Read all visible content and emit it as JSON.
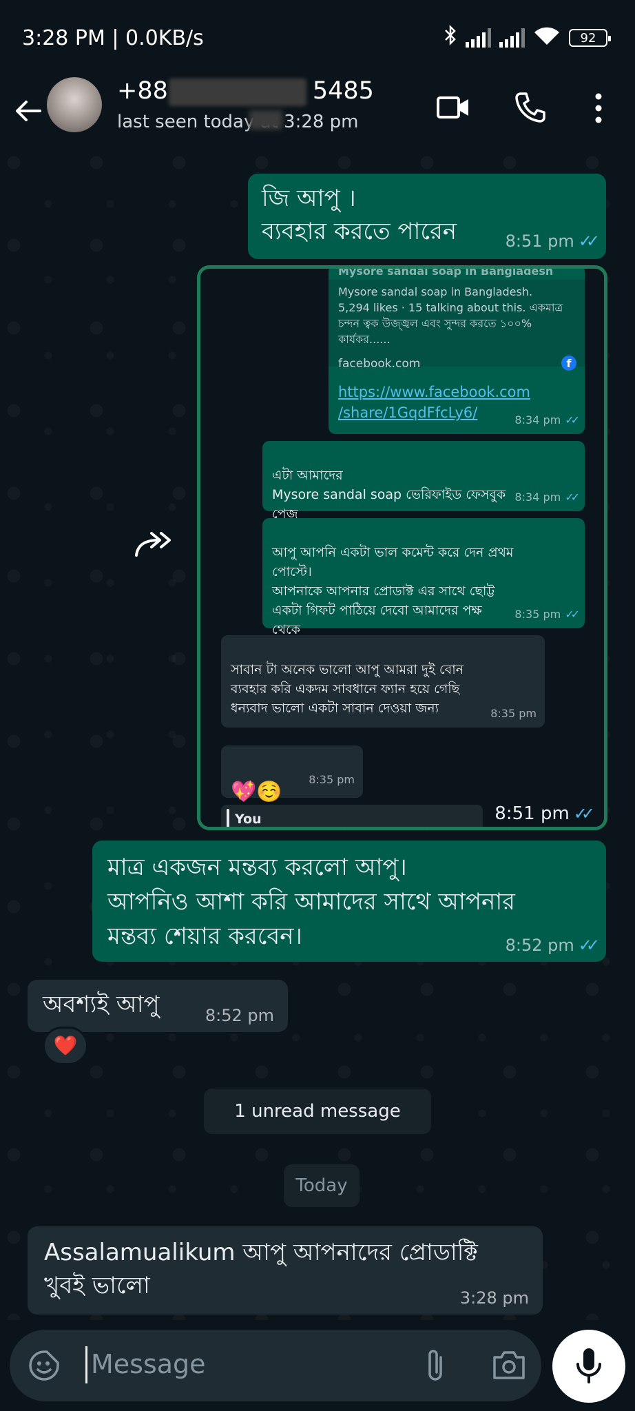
{
  "status_bar": {
    "time": "3:28 PM | 0.0KB/s",
    "battery": "92",
    "icons": [
      "bluetooth-icon",
      "signal-icon",
      "signal-icon",
      "wifi-icon",
      "battery-icon"
    ]
  },
  "header": {
    "contact_name": "+88",
    "contact_suffix": "5485",
    "last_seen": "last seen today at 3:28 pm",
    "icons": [
      "back-arrow-icon",
      "video-call-icon",
      "voice-call-icon",
      "more-options-icon"
    ]
  },
  "messages": {
    "m1": {
      "text": "জি আপু ।\nব্যবহার করতে পারেন",
      "time": "8:51 pm"
    },
    "forwarded": {
      "link_title": "Mysore sandal soap in Bangladesh",
      "link_desc": "Mysore sandal soap in Bangladesh.\n5,294 likes · 15 talking about this. একমাত্র\nচন্দন ত্বক উজ্জ্বল এবং সুন্দর করতে ১০০%\nকার্যকর......",
      "link_domain": "facebook.com",
      "link_url": "https://www.facebook.com\n/share/1GqdFfcLy6/",
      "link_time": "8:34 pm",
      "s1": {
        "text": "এটা আমাদের\nMysore sandal soap ভেরিফাইড ফেসবুক\nপেজ",
        "time": "8:34 pm"
      },
      "s2": {
        "text": "আপু আপনি একটা ভাল কমেন্ট করে দেন প্রথম\nপোস্টে।\nআপনাকে আপনার প্রোডাক্ট এর সাথে ছোট্ট\nএকটা গিফট পাঠিয়ে দেবো আমাদের পক্ষ\nথেকে",
        "time": "8:35 pm"
      },
      "s3": {
        "text": "সাবান টা অনেক ভালো আপু আমরা দুই বোন\nব্যবহার করি একদম সাবধানে ফ্যান হয়ে গেছি\nধন্যবাদ ভালো একটা সাবান দেওয়া জন্য",
        "time": "8:35 pm"
      },
      "s4": {
        "text": "💖☺️",
        "time": "8:35 pm"
      },
      "reply_label": "You",
      "outer_time": "8:51 pm"
    },
    "m2": {
      "text": "মাত্র একজন মন্তব্য করলো আপু।\nআপনিও আশা করি আমাদের সাথে আপনার\nমন্তব্য শেয়ার করবেন।",
      "time": "8:52 pm"
    },
    "m3": {
      "text": "অবশ্যই  আপু",
      "time": "8:52 pm",
      "reaction": "❤️"
    },
    "unread": "1 unread message",
    "date_pill": "Today",
    "m4": {
      "text": "Assalamualikum  আপু আপনাদের প্রোডাক্টি\nখুবই ভালো",
      "time": "3:28 pm"
    }
  },
  "input": {
    "placeholder": "Message",
    "icons": [
      "emoji-sticker-icon",
      "attach-icon",
      "camera-icon",
      "mic-icon"
    ]
  },
  "colors": {
    "outgoing": "#005c4b",
    "incoming": "#202c33",
    "background": "#0b141a",
    "read_ticks": "#53bdeb",
    "frame": "#1f7a5a"
  }
}
